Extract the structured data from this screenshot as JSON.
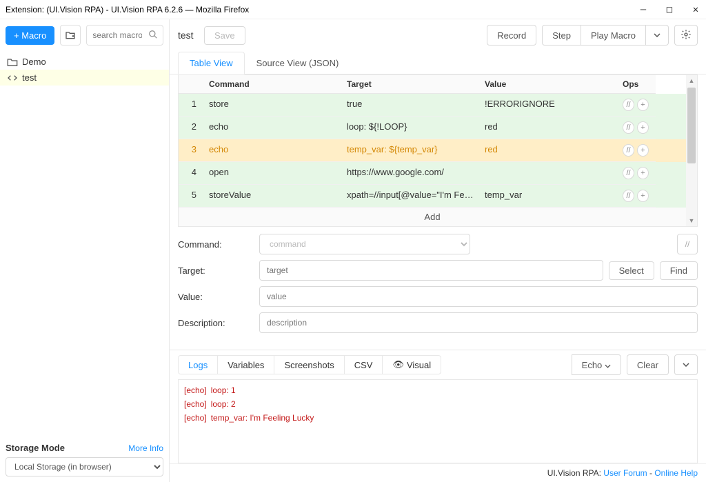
{
  "window": {
    "title": "Extension: (UI.Vision RPA) - UI.Vision RPA 6.2.6 — Mozilla Firefox"
  },
  "sidebar": {
    "new_macro_btn": "+ Macro",
    "search_placeholder": "search macro",
    "items": [
      {
        "label": "Demo",
        "type": "folder"
      },
      {
        "label": "test",
        "type": "macro"
      }
    ],
    "storage": {
      "label": "Storage Mode",
      "more_info": "More Info",
      "selected": "Local Storage (in browser)"
    }
  },
  "toolbar": {
    "macro_name": "test",
    "save_btn": "Save",
    "record_btn": "Record",
    "step_btn": "Step",
    "play_btn": "Play Macro"
  },
  "view_tabs": {
    "table": "Table View",
    "source": "Source View (JSON)"
  },
  "table": {
    "headers": {
      "cmd": "Command",
      "target": "Target",
      "value": "Value",
      "ops": "Ops"
    },
    "rows": [
      {
        "n": "1",
        "cmd": "store",
        "target": "true",
        "value": "!ERRORIGNORE",
        "cls": "row-even"
      },
      {
        "n": "2",
        "cmd": "echo",
        "target": "loop: ${!LOOP}",
        "value": "red",
        "cls": "row-even"
      },
      {
        "n": "3",
        "cmd": "echo",
        "target": "temp_var: ${temp_var}",
        "value": "red",
        "cls": "row-selected"
      },
      {
        "n": "4",
        "cmd": "open",
        "target": "https://www.google.com/",
        "value": "",
        "cls": "row-even"
      },
      {
        "n": "5",
        "cmd": "storeValue",
        "target": "xpath=//input[@value=\"I'm Feeling L…",
        "value": "temp_var",
        "cls": "row-even"
      }
    ],
    "add": "Add"
  },
  "form": {
    "command_label": "Command:",
    "command_placeholder": "command",
    "target_label": "Target:",
    "target_placeholder": "target",
    "select_btn": "Select",
    "find_btn": "Find",
    "value_label": "Value:",
    "value_placeholder": "value",
    "description_label": "Description:",
    "description_placeholder": "description",
    "comment_btn": "//"
  },
  "bottom": {
    "tabs": {
      "logs": "Logs",
      "vars": "Variables",
      "shots": "Screenshots",
      "csv": "CSV",
      "visual": "Visual"
    },
    "echo_label": "Echo",
    "clear_btn": "Clear",
    "logs": [
      {
        "tag": "[echo]",
        "msg": "loop: 1"
      },
      {
        "tag": "[echo]",
        "msg": "loop: 2"
      },
      {
        "tag": "[echo]",
        "msg": "temp_var: I'm Feeling Lucky"
      }
    ]
  },
  "footer": {
    "prefix": "UI.Vision RPA: ",
    "forum": "User Forum",
    "sep": " - ",
    "help": "Online Help"
  }
}
